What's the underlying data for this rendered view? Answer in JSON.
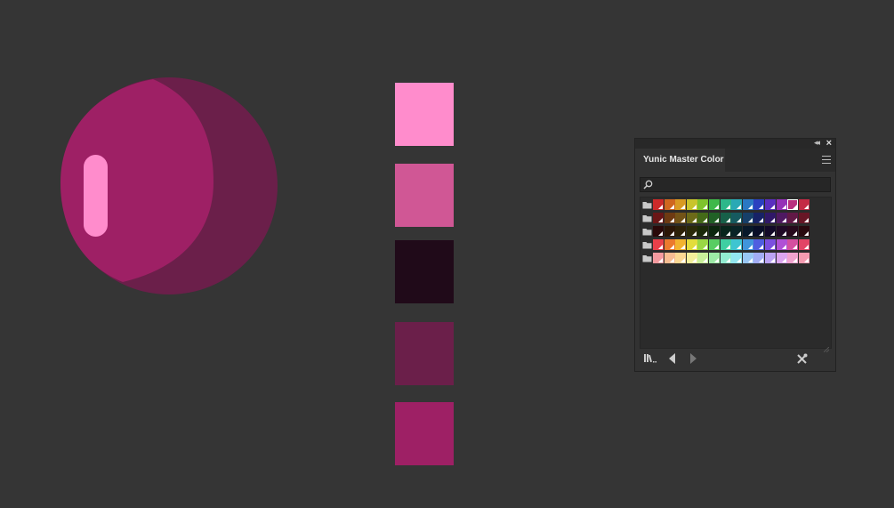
{
  "panel": {
    "title": "Yunic Master Color",
    "search": {
      "value": "",
      "placeholder": ""
    },
    "icons": [
      "collapse-icon",
      "close-icon",
      "menu-icon",
      "search-icon",
      "folder-icon",
      "library-icon",
      "previous-icon",
      "next-icon",
      "tools-icon"
    ]
  },
  "artboard": {
    "sphere_colors": {
      "shadow": "#6b1f4a",
      "body": "#9e2065",
      "highlight": "#ff8ccc"
    },
    "swatches": [
      "#ff8ccc",
      "#d05795",
      "#200a19",
      "#6b1f4a",
      "#9e2065"
    ]
  },
  "swatch_groups": [
    {
      "name": "row-1",
      "colors": [
        "#cc2a2a",
        "#d0671f",
        "#d99a22",
        "#c9c42c",
        "#7fc32d",
        "#3fb84a",
        "#2db78a",
        "#2aa9b5",
        "#2a78c4",
        "#2a40c0",
        "#5a2ec0",
        "#9530b8",
        "#b8307f",
        "#c42a45"
      ],
      "selected_index": 12
    },
    {
      "name": "row-2",
      "colors": [
        "#6a1616",
        "#6e3a12",
        "#735317",
        "#6c6a18",
        "#446a18",
        "#216126",
        "#176049",
        "#165a60",
        "#163f69",
        "#172266",
        "#301868",
        "#4f1962",
        "#621946",
        "#681626"
      ],
      "selected_index": -1
    },
    {
      "name": "row-3",
      "colors": [
        "#2a0909",
        "#2b1607",
        "#2d2109",
        "#2a2909",
        "#1a2909",
        "#0c260f",
        "#08251c",
        "#082326",
        "#08192a",
        "#090e28",
        "#130a29",
        "#1f0a26",
        "#270a1c",
        "#29090f"
      ],
      "selected_index": -1
    },
    {
      "name": "row-4",
      "colors": [
        "#e8404a",
        "#ec7a2e",
        "#f2b32f",
        "#e3dd3c",
        "#9ad845",
        "#58cd62",
        "#40cfa2",
        "#3ec5d1",
        "#4095dc",
        "#4f5ee0",
        "#7b4fe0",
        "#b050d6",
        "#d54fa0",
        "#e34466"
      ],
      "selected_index": -1
    },
    {
      "name": "row-5",
      "colors": [
        "#f49a9f",
        "#f7bc92",
        "#fbd893",
        "#f3ef9a",
        "#c9f09a",
        "#9deaa6",
        "#93ecd1",
        "#93e6ef",
        "#98c6f4",
        "#a2acf4",
        "#bba3f4",
        "#dba5ef",
        "#f0a3cf",
        "#f49bb0"
      ],
      "selected_index": -1
    }
  ]
}
